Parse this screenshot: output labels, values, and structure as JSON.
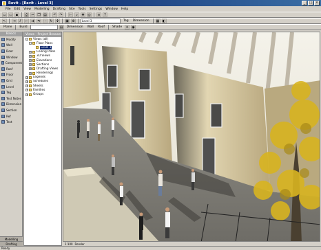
{
  "window": {
    "title": "Revit - [Revit - Level 3]"
  },
  "menu": [
    "File",
    "Edit",
    "View",
    "Modelling",
    "Drafting",
    "Site",
    "Tools",
    "Settings",
    "Window",
    "Help"
  ],
  "toolbar2": {
    "level_label": "Level 3",
    "tag_label": "Tag",
    "dim_label": "Dimension"
  },
  "toolbar3": {
    "floor_label": "Plane",
    "build_label": "Build",
    "detail_label": "Dimension",
    "wall_label": "Wall",
    "roof_label": "Roof",
    "shading_label": "Shade"
  },
  "left_panel": {
    "header": "Basics",
    "tools": [
      "Modify",
      "Wall",
      "Door",
      "Window",
      "Component",
      "Roof",
      "Floor",
      "Grid",
      "Level",
      "Tag",
      "Text Notes",
      "Dimension",
      "Section",
      "Ref",
      "Text"
    ],
    "footer_tabs": [
      "Modelling",
      "Drafting"
    ]
  },
  "browser": {
    "header": "Views - Project Browser",
    "rows": [
      {
        "label": "Views (all)",
        "indent": 0,
        "sign": "-"
      },
      {
        "label": "Floor Plans",
        "indent": 1,
        "sign": "-"
      },
      {
        "label": "Level 3",
        "indent": 2,
        "sign": "",
        "selected": true
      },
      {
        "label": "Ceiling Plans",
        "indent": 1,
        "sign": "+"
      },
      {
        "label": "3D Views",
        "indent": 1,
        "sign": "+"
      },
      {
        "label": "Elevations",
        "indent": 1,
        "sign": "+"
      },
      {
        "label": "Sections",
        "indent": 1,
        "sign": "+"
      },
      {
        "label": "Drafting Views",
        "indent": 1,
        "sign": "+"
      },
      {
        "label": "Renderings",
        "indent": 1,
        "sign": "+"
      },
      {
        "label": "Legends",
        "indent": 0,
        "sign": "+"
      },
      {
        "label": "Schedules",
        "indent": 0,
        "sign": "+"
      },
      {
        "label": "Sheets",
        "indent": 0,
        "sign": "+"
      },
      {
        "label": "Families",
        "indent": 0,
        "sign": "+"
      },
      {
        "label": "Groups",
        "indent": 0,
        "sign": "+"
      }
    ]
  },
  "status": {
    "text": "Ready"
  },
  "view_controls": [
    "1:100",
    "Render"
  ]
}
